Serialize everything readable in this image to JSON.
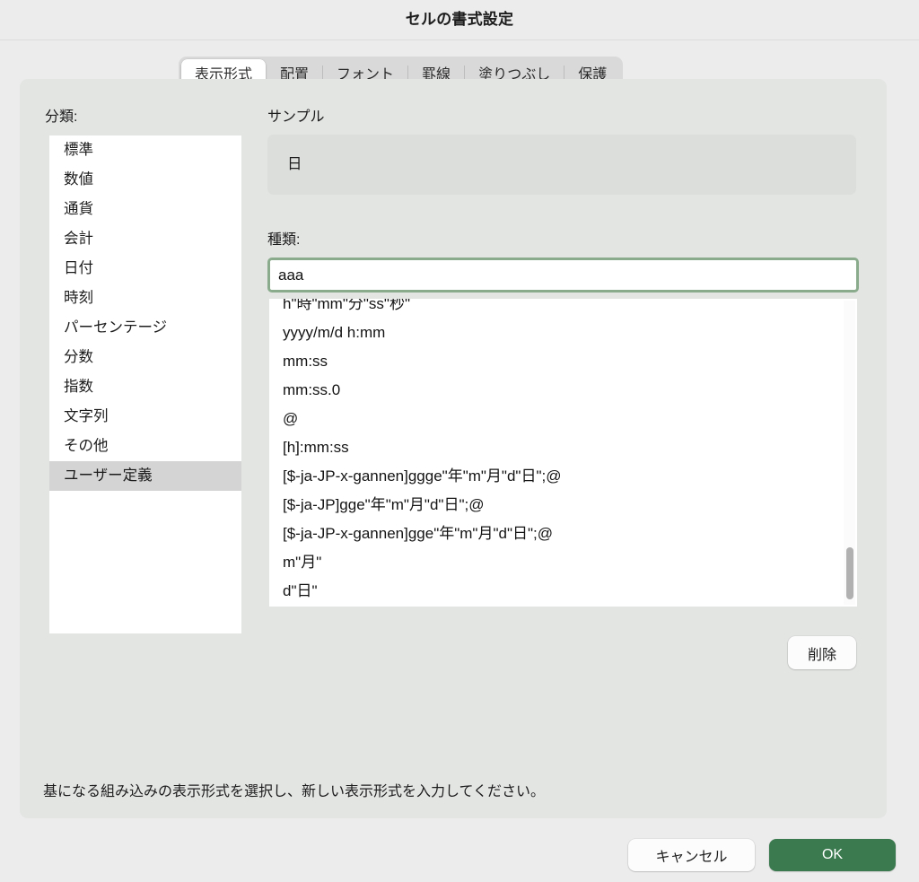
{
  "window": {
    "title": "セルの書式設定"
  },
  "tabs": [
    {
      "label": "表示形式",
      "selected": true
    },
    {
      "label": "配置",
      "selected": false
    },
    {
      "label": "フォント",
      "selected": false
    },
    {
      "label": "罫線",
      "selected": false
    },
    {
      "label": "塗りつぶし",
      "selected": false
    },
    {
      "label": "保護",
      "selected": false
    }
  ],
  "category": {
    "label": "分類:",
    "items": [
      {
        "label": "標準",
        "selected": false
      },
      {
        "label": "数値",
        "selected": false
      },
      {
        "label": "通貨",
        "selected": false
      },
      {
        "label": "会計",
        "selected": false
      },
      {
        "label": "日付",
        "selected": false
      },
      {
        "label": "時刻",
        "selected": false
      },
      {
        "label": "パーセンテージ",
        "selected": false
      },
      {
        "label": "分数",
        "selected": false
      },
      {
        "label": "指数",
        "selected": false
      },
      {
        "label": "文字列",
        "selected": false
      },
      {
        "label": "その他",
        "selected": false
      },
      {
        "label": "ユーザー定義",
        "selected": true
      }
    ]
  },
  "sample": {
    "label": "サンプル",
    "value": "日"
  },
  "type": {
    "label": "種類:",
    "value": "aaa",
    "placeholder": ""
  },
  "format_list": {
    "items": [
      "h\"時\"mm\"分\"ss\"秒\"",
      "yyyy/m/d h:mm",
      "mm:ss",
      "mm:ss.0",
      "@",
      "[h]:mm:ss",
      "[$-ja-JP-x-gannen]ggge\"年\"m\"月\"d\"日\";@",
      "[$-ja-JP]gge\"年\"m\"月\"d\"日\";@",
      "[$-ja-JP-x-gannen]gge\"年\"m\"月\"d\"日\";@",
      "m\"月\"",
      "d\"日\""
    ]
  },
  "buttons": {
    "delete": "削除",
    "cancel": "キャンセル",
    "ok": "OK"
  },
  "hint": "基になる組み込みの表示形式を選択し、新しい表示形式を入力してください。",
  "colors": {
    "accent_ok": "#3a7a4e",
    "focus_border": "#8aab8c",
    "window_background": "#ececec",
    "panel_background": "#e3e5e3",
    "selection": "#d4d4d4"
  }
}
